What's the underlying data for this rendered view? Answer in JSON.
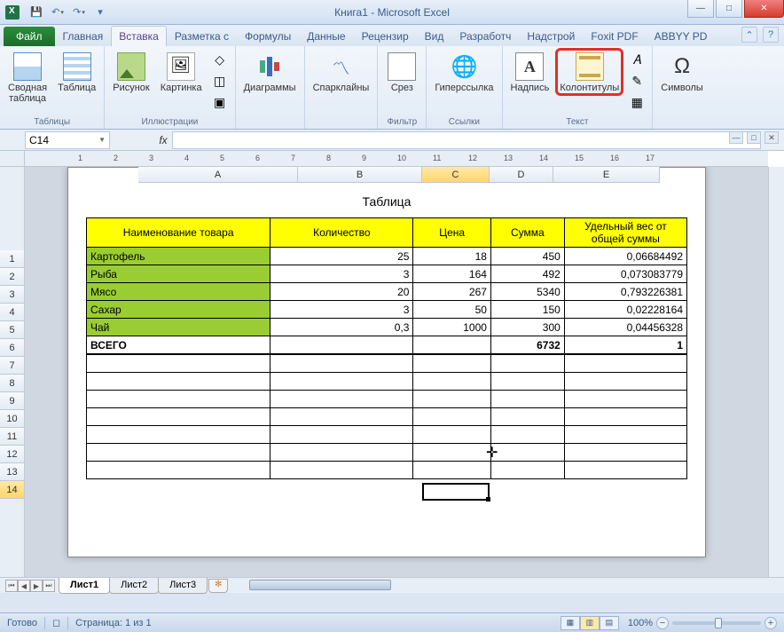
{
  "title": "Книга1 - Microsoft Excel",
  "qat": {
    "save": "💾",
    "undo": "↶",
    "redo": "↷"
  },
  "tabs": {
    "file": "Файл",
    "items": [
      "Главная",
      "Вставка",
      "Разметка с",
      "Формулы",
      "Данные",
      "Рецензир",
      "Вид",
      "Разработч",
      "Надстрой",
      "Foxit PDF",
      "ABBYY PD"
    ],
    "activeIndex": 1
  },
  "ribbon": {
    "tables": {
      "label": "Таблицы",
      "pivot": "Сводная\nтаблица",
      "table": "Таблица"
    },
    "illust": {
      "label": "Иллюстрации",
      "pic": "Рисунок",
      "clip": "Картинка"
    },
    "charts": {
      "label": "",
      "chart": "Диаграммы"
    },
    "spark": {
      "label": "",
      "btn": "Спарклайны"
    },
    "filter": {
      "label": "Фильтр",
      "slicer": "Срез"
    },
    "links": {
      "label": "Ссылки",
      "link": "Гиперссылка"
    },
    "text": {
      "label": "Текст",
      "textbox": "Надпись",
      "hf": "Колонтитулы"
    },
    "symbols": {
      "label": "",
      "sym": "Символы"
    }
  },
  "namebox": "C14",
  "fx": "fx",
  "pageTitle": "Таблица",
  "headers": [
    "Наименование товара",
    "Количество",
    "Цена",
    "Сумма",
    "Удельный вес от общей суммы"
  ],
  "rows": [
    {
      "name": "Картофель",
      "qty": "25",
      "price": "18",
      "sum": "450",
      "share": "0,06684492"
    },
    {
      "name": "Рыба",
      "qty": "3",
      "price": "164",
      "sum": "492",
      "share": "0,073083779"
    },
    {
      "name": "Мясо",
      "qty": "20",
      "price": "267",
      "sum": "5340",
      "share": "0,793226381"
    },
    {
      "name": "Сахар",
      "qty": "3",
      "price": "50",
      "sum": "150",
      "share": "0,02228164"
    },
    {
      "name": "Чай",
      "qty": "0,3",
      "price": "1000",
      "sum": "300",
      "share": "0,04456328"
    }
  ],
  "total": {
    "label": "ВСЕГО",
    "sum": "6732",
    "share": "1"
  },
  "colLetters": [
    "A",
    "B",
    "C",
    "D",
    "E"
  ],
  "rowNums": [
    "1",
    "2",
    "3",
    "4",
    "5",
    "6",
    "7",
    "8",
    "9",
    "10",
    "11",
    "12",
    "13",
    "14"
  ],
  "rulerNums": [
    "1",
    "2",
    "3",
    "4",
    "5",
    "6",
    "7",
    "8",
    "9",
    "10",
    "11",
    "12",
    "13",
    "14",
    "15",
    "16",
    "17"
  ],
  "sheets": [
    "Лист1",
    "Лист2",
    "Лист3"
  ],
  "status": {
    "ready": "Готово",
    "page": "Страница: 1 из 1",
    "zoom": "100%"
  },
  "chart_data": {
    "type": "table",
    "title": "Таблица",
    "columns": [
      "Наименование товара",
      "Количество",
      "Цена",
      "Сумма",
      "Удельный вес от общей суммы"
    ],
    "rows": [
      [
        "Картофель",
        25,
        18,
        450,
        0.06684492
      ],
      [
        "Рыба",
        3,
        164,
        492,
        0.073083779
      ],
      [
        "Мясо",
        20,
        267,
        5340,
        0.793226381
      ],
      [
        "Сахар",
        3,
        50,
        150,
        0.02228164
      ],
      [
        "Чай",
        0.3,
        1000,
        300,
        0.04456328
      ]
    ],
    "totals": [
      "ВСЕГО",
      null,
      null,
      6732,
      1
    ]
  }
}
